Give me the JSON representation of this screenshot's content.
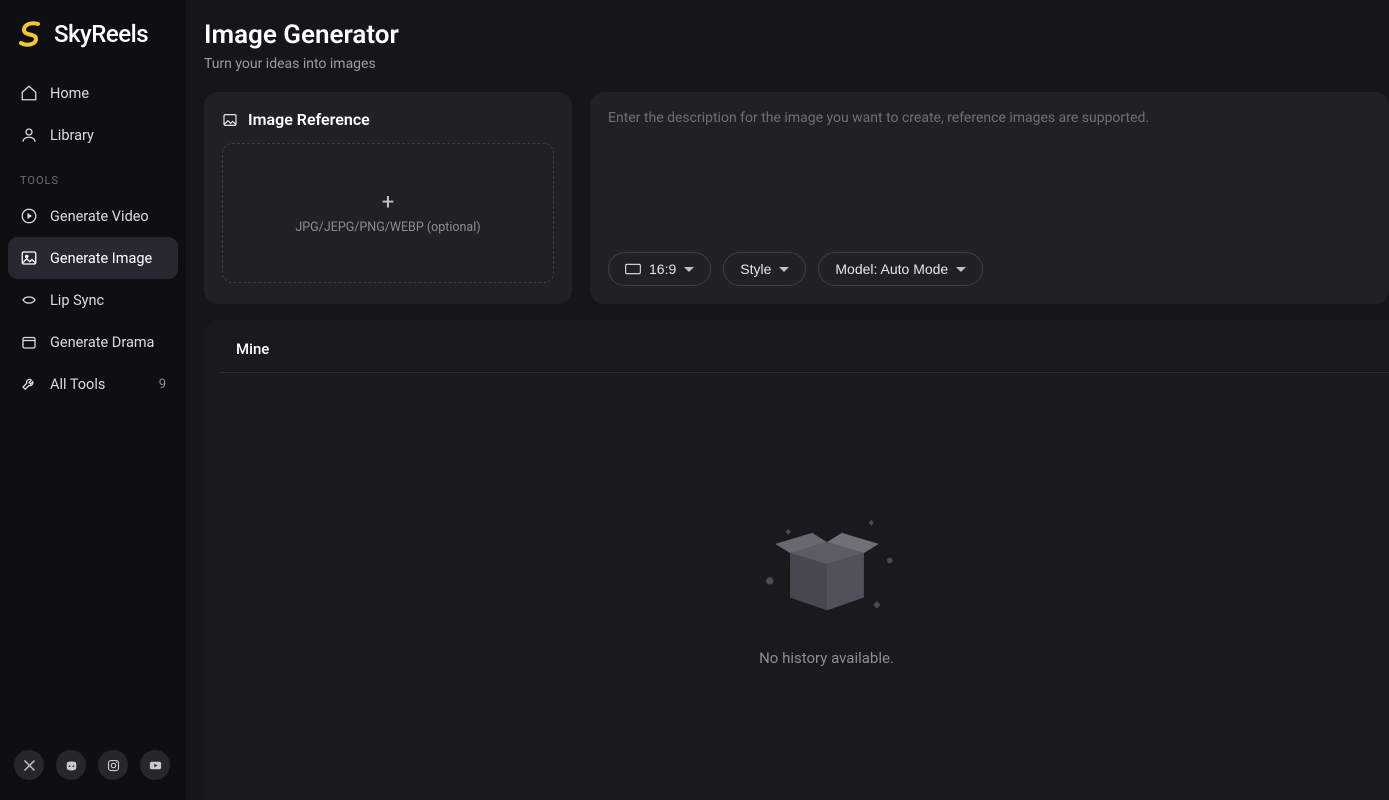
{
  "brand": {
    "name": "SkyReels"
  },
  "sidebar": {
    "nav": [
      {
        "label": "Home"
      },
      {
        "label": "Library"
      }
    ],
    "tools_heading": "TOOLS",
    "tools": [
      {
        "label": "Generate Video"
      },
      {
        "label": "Generate Image"
      },
      {
        "label": "Lip Sync"
      },
      {
        "label": "Generate Drama"
      },
      {
        "label": "All Tools",
        "badge": "9"
      }
    ]
  },
  "header": {
    "title": "Image Generator",
    "subtitle": "Turn your ideas into images"
  },
  "reference_panel": {
    "title": "Image Reference",
    "dropzone_hint": "JPG/JEPG/PNG/WEBP (optional)"
  },
  "prompt_panel": {
    "placeholder": "Enter the description for the image you want to create, reference images are supported.",
    "aspect_ratio": "16:9",
    "style_label": "Style",
    "model_label": "Model: Auto Mode"
  },
  "history": {
    "tab": "Mine",
    "empty_text": "No history available."
  }
}
